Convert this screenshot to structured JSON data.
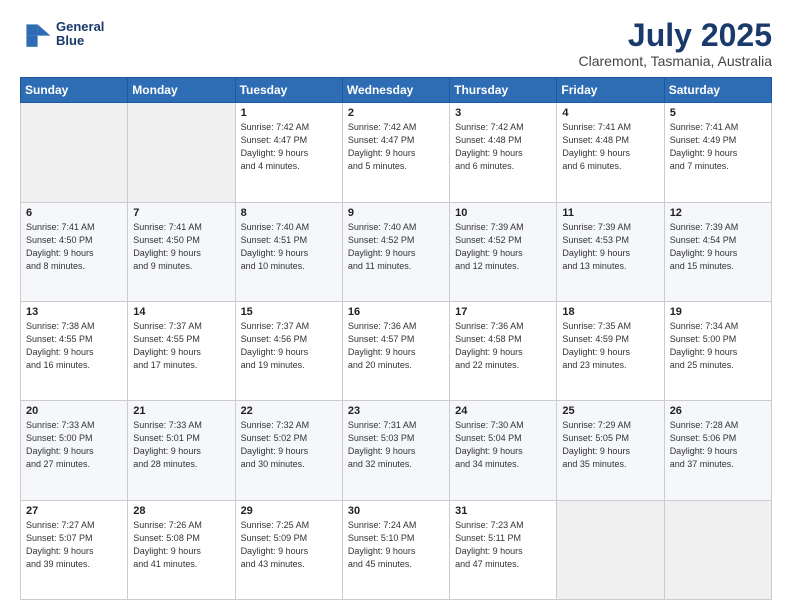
{
  "logo": {
    "line1": "General",
    "line2": "Blue"
  },
  "title": "July 2025",
  "subtitle": "Claremont, Tasmania, Australia",
  "headers": [
    "Sunday",
    "Monday",
    "Tuesday",
    "Wednesday",
    "Thursday",
    "Friday",
    "Saturday"
  ],
  "weeks": [
    [
      {
        "day": "",
        "info": ""
      },
      {
        "day": "",
        "info": ""
      },
      {
        "day": "1",
        "info": "Sunrise: 7:42 AM\nSunset: 4:47 PM\nDaylight: 9 hours\nand 4 minutes."
      },
      {
        "day": "2",
        "info": "Sunrise: 7:42 AM\nSunset: 4:47 PM\nDaylight: 9 hours\nand 5 minutes."
      },
      {
        "day": "3",
        "info": "Sunrise: 7:42 AM\nSunset: 4:48 PM\nDaylight: 9 hours\nand 6 minutes."
      },
      {
        "day": "4",
        "info": "Sunrise: 7:41 AM\nSunset: 4:48 PM\nDaylight: 9 hours\nand 6 minutes."
      },
      {
        "day": "5",
        "info": "Sunrise: 7:41 AM\nSunset: 4:49 PM\nDaylight: 9 hours\nand 7 minutes."
      }
    ],
    [
      {
        "day": "6",
        "info": "Sunrise: 7:41 AM\nSunset: 4:50 PM\nDaylight: 9 hours\nand 8 minutes."
      },
      {
        "day": "7",
        "info": "Sunrise: 7:41 AM\nSunset: 4:50 PM\nDaylight: 9 hours\nand 9 minutes."
      },
      {
        "day": "8",
        "info": "Sunrise: 7:40 AM\nSunset: 4:51 PM\nDaylight: 9 hours\nand 10 minutes."
      },
      {
        "day": "9",
        "info": "Sunrise: 7:40 AM\nSunset: 4:52 PM\nDaylight: 9 hours\nand 11 minutes."
      },
      {
        "day": "10",
        "info": "Sunrise: 7:39 AM\nSunset: 4:52 PM\nDaylight: 9 hours\nand 12 minutes."
      },
      {
        "day": "11",
        "info": "Sunrise: 7:39 AM\nSunset: 4:53 PM\nDaylight: 9 hours\nand 13 minutes."
      },
      {
        "day": "12",
        "info": "Sunrise: 7:39 AM\nSunset: 4:54 PM\nDaylight: 9 hours\nand 15 minutes."
      }
    ],
    [
      {
        "day": "13",
        "info": "Sunrise: 7:38 AM\nSunset: 4:55 PM\nDaylight: 9 hours\nand 16 minutes."
      },
      {
        "day": "14",
        "info": "Sunrise: 7:37 AM\nSunset: 4:55 PM\nDaylight: 9 hours\nand 17 minutes."
      },
      {
        "day": "15",
        "info": "Sunrise: 7:37 AM\nSunset: 4:56 PM\nDaylight: 9 hours\nand 19 minutes."
      },
      {
        "day": "16",
        "info": "Sunrise: 7:36 AM\nSunset: 4:57 PM\nDaylight: 9 hours\nand 20 minutes."
      },
      {
        "day": "17",
        "info": "Sunrise: 7:36 AM\nSunset: 4:58 PM\nDaylight: 9 hours\nand 22 minutes."
      },
      {
        "day": "18",
        "info": "Sunrise: 7:35 AM\nSunset: 4:59 PM\nDaylight: 9 hours\nand 23 minutes."
      },
      {
        "day": "19",
        "info": "Sunrise: 7:34 AM\nSunset: 5:00 PM\nDaylight: 9 hours\nand 25 minutes."
      }
    ],
    [
      {
        "day": "20",
        "info": "Sunrise: 7:33 AM\nSunset: 5:00 PM\nDaylight: 9 hours\nand 27 minutes."
      },
      {
        "day": "21",
        "info": "Sunrise: 7:33 AM\nSunset: 5:01 PM\nDaylight: 9 hours\nand 28 minutes."
      },
      {
        "day": "22",
        "info": "Sunrise: 7:32 AM\nSunset: 5:02 PM\nDaylight: 9 hours\nand 30 minutes."
      },
      {
        "day": "23",
        "info": "Sunrise: 7:31 AM\nSunset: 5:03 PM\nDaylight: 9 hours\nand 32 minutes."
      },
      {
        "day": "24",
        "info": "Sunrise: 7:30 AM\nSunset: 5:04 PM\nDaylight: 9 hours\nand 34 minutes."
      },
      {
        "day": "25",
        "info": "Sunrise: 7:29 AM\nSunset: 5:05 PM\nDaylight: 9 hours\nand 35 minutes."
      },
      {
        "day": "26",
        "info": "Sunrise: 7:28 AM\nSunset: 5:06 PM\nDaylight: 9 hours\nand 37 minutes."
      }
    ],
    [
      {
        "day": "27",
        "info": "Sunrise: 7:27 AM\nSunset: 5:07 PM\nDaylight: 9 hours\nand 39 minutes."
      },
      {
        "day": "28",
        "info": "Sunrise: 7:26 AM\nSunset: 5:08 PM\nDaylight: 9 hours\nand 41 minutes."
      },
      {
        "day": "29",
        "info": "Sunrise: 7:25 AM\nSunset: 5:09 PM\nDaylight: 9 hours\nand 43 minutes."
      },
      {
        "day": "30",
        "info": "Sunrise: 7:24 AM\nSunset: 5:10 PM\nDaylight: 9 hours\nand 45 minutes."
      },
      {
        "day": "31",
        "info": "Sunrise: 7:23 AM\nSunset: 5:11 PM\nDaylight: 9 hours\nand 47 minutes."
      },
      {
        "day": "",
        "info": ""
      },
      {
        "day": "",
        "info": ""
      }
    ]
  ]
}
